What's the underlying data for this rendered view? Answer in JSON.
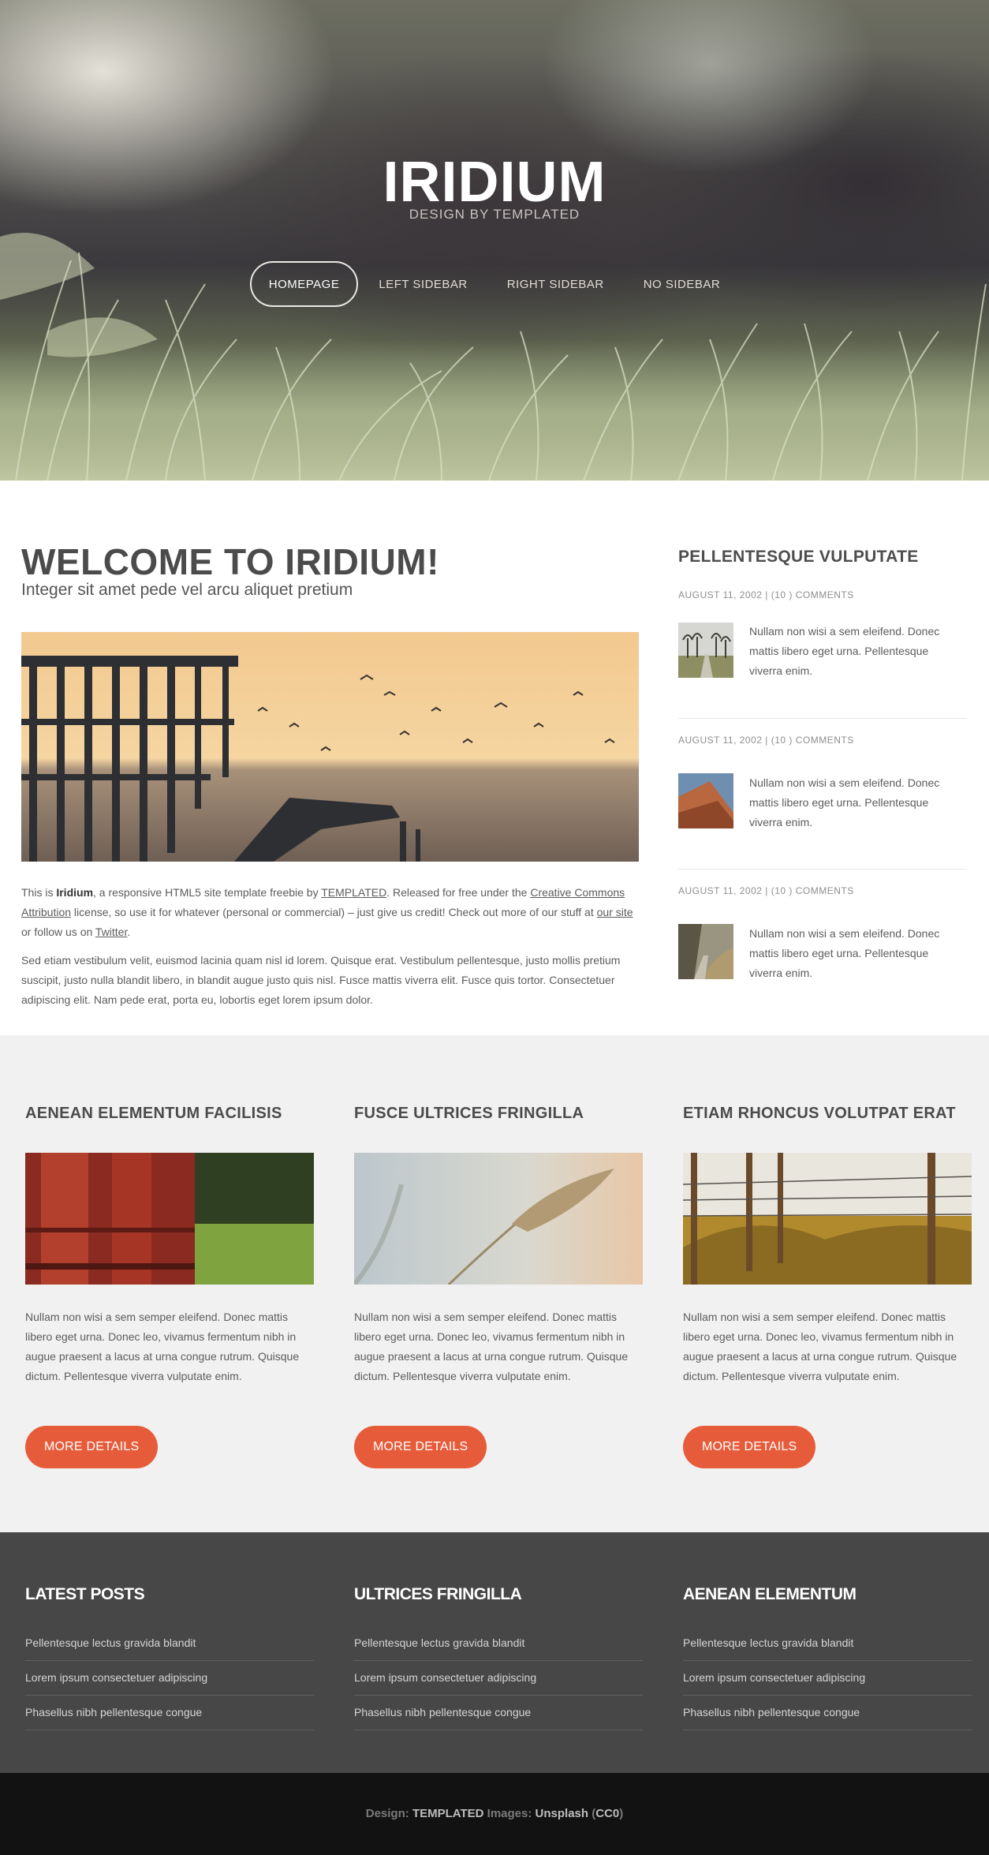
{
  "header": {
    "title": "IRIDIUM",
    "subtitle": "DESIGN BY TEMPLATED",
    "nav": [
      {
        "label": "HOMEPAGE",
        "active": true
      },
      {
        "label": "LEFT SIDEBAR",
        "active": false
      },
      {
        "label": "RIGHT SIDEBAR",
        "active": false
      },
      {
        "label": "NO SIDEBAR",
        "active": false
      }
    ]
  },
  "main": {
    "heading": "WELCOME TO IRIDIUM!",
    "subheading": "Integer sit amet pede vel arcu aliquet pretium",
    "intro": {
      "t1": "This is ",
      "name": "Iridium",
      "t2": ", a responsive HTML5 site template freebie by ",
      "link1": "TEMPLATED",
      "t3": ". Released for free under the ",
      "link2": "Creative Commons Attribution",
      "t4": " license, so use it for whatever (personal or commercial) – just give us credit! Check out more of our stuff at ",
      "link3": "our site",
      "t5": " or follow us on ",
      "link4": "Twitter",
      "t6": "."
    },
    "paragraph2": "Sed etiam vestibulum velit, euismod lacinia quam nisl id lorem. Quisque erat. Vestibulum pellentesque, justo mollis pretium suscipit, justo nulla blandit libero, in blandit augue justo quis nisl. Fusce mattis viverra elit. Fusce quis tortor. Consectetuer adipiscing elit. Nam pede erat, porta eu, lobortis eget lorem ipsum dolor."
  },
  "sidebar": {
    "title": "PELLENTESQUE VULPUTATE",
    "posts": [
      {
        "date": "AUGUST 11, 2002 | (10 ) COMMENTS",
        "text": "Nullam non wisi a sem eleifend. Donec mattis libero eget urna. Pellentesque viverra enim."
      },
      {
        "date": "AUGUST 11, 2002 | (10 ) COMMENTS",
        "text": "Nullam non wisi a sem eleifend. Donec mattis libero eget urna. Pellentesque viverra enim."
      },
      {
        "date": "AUGUST 11, 2002 | (10 ) COMMENTS",
        "text": "Nullam non wisi a sem eleifend. Donec mattis libero eget urna. Pellentesque viverra enim."
      }
    ]
  },
  "featured": [
    {
      "title": "AENEAN ELEMENTUM FACILISIS",
      "text": "Nullam non wisi a sem semper eleifend. Donec mattis libero eget urna. Donec leo, vivamus fermentum nibh in augue praesent a lacus at urna congue rutrum. Quisque dictum. Pellentesque viverra vulputate enim.",
      "button": "MORE DETAILS"
    },
    {
      "title": "FUSCE ULTRICES FRINGILLA",
      "text": "Nullam non wisi a sem semper eleifend. Donec mattis libero eget urna. Donec leo, vivamus fermentum nibh in augue praesent a lacus at urna congue rutrum. Quisque dictum. Pellentesque viverra vulputate enim.",
      "button": "MORE DETAILS"
    },
    {
      "title": "ETIAM RHONCUS VOLUTPAT ERAT",
      "text": "Nullam non wisi a sem semper eleifend. Donec mattis libero eget urna. Donec leo, vivamus fermentum nibh in augue praesent a lacus at urna congue rutrum. Quisque dictum. Pellentesque viverra vulputate enim.",
      "button": "MORE DETAILS"
    }
  ],
  "footer": {
    "columns": [
      {
        "title": "LATEST POSTS",
        "links": [
          "Pellentesque lectus gravida blandit",
          "Lorem ipsum consectetuer adipiscing",
          "Phasellus nibh pellentesque congue"
        ]
      },
      {
        "title": "ULTRICES FRINGILLA",
        "links": [
          "Pellentesque lectus gravida blandit",
          "Lorem ipsum consectetuer adipiscing",
          "Phasellus nibh pellentesque congue"
        ]
      },
      {
        "title": "AENEAN ELEMENTUM",
        "links": [
          "Pellentesque lectus gravida blandit",
          "Lorem ipsum consectetuer adipiscing",
          "Phasellus nibh pellentesque congue"
        ]
      }
    ]
  },
  "copyright": {
    "design_label": "Design:",
    "design_value": "TEMPLATED",
    "images_label": "Images:",
    "images_value": "Unsplash",
    "license_open": " (",
    "license_value": "CC0",
    "license_close": ")"
  },
  "colors": {
    "accent": "#e65c3b",
    "footer": "#474747",
    "copyright_bg": "#121212",
    "featured_bg": "#f1f1f1"
  }
}
